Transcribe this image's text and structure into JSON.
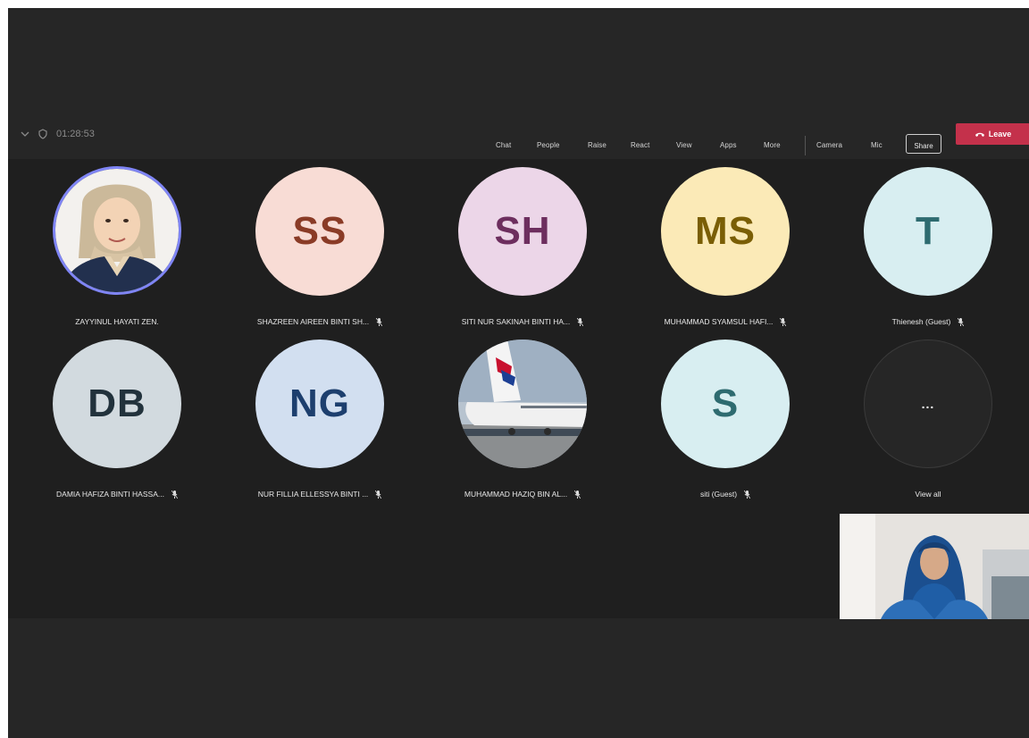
{
  "toolbar": {
    "timer": "01:28:53",
    "items": [
      "Chat",
      "People",
      "Raise",
      "React",
      "View",
      "Apps",
      "More",
      "Camera",
      "Mic"
    ],
    "share_label": "Share",
    "leave_label": "Leave"
  },
  "participants": [
    {
      "initials": "",
      "name": "ZAYYINUL HAYATI ZEN.",
      "bg": "#ffffff",
      "fg": "#000000",
      "photo": "woman-portrait",
      "muted": false,
      "speaking": true
    },
    {
      "initials": "SS",
      "name": "SHAZREEN AIREEN BINTI SH...",
      "bg": "#f8dcd5",
      "fg": "#8a3b26",
      "muted": true
    },
    {
      "initials": "SH",
      "name": "SITI NUR SAKINAH BINTI HA...",
      "bg": "#ecd6e8",
      "fg": "#6d2e5e",
      "muted": true
    },
    {
      "initials": "MS",
      "name": "MUHAMMAD SYAMSUL HAFI...",
      "bg": "#fbeab7",
      "fg": "#7a5e05",
      "muted": true
    },
    {
      "initials": "T",
      "name": "Thienesh (Guest)",
      "bg": "#d8eef1",
      "fg": "#2e6b70",
      "muted": true
    },
    {
      "initials": "DB",
      "name": "DAMIA HAFIZA BINTI HASSA...",
      "bg": "#d2dadf",
      "fg": "#22323c",
      "muted": true
    },
    {
      "initials": "NG",
      "name": "NUR FILLIA ELLESSYA BINTI ...",
      "bg": "#d2dff0",
      "fg": "#1d3f6e",
      "muted": true
    },
    {
      "initials": "",
      "name": "MUHAMMAD HAZIQ BIN AL...",
      "bg": "#9fb0bf",
      "fg": "#000000",
      "photo": "airplane",
      "muted": true
    },
    {
      "initials": "S",
      "name": "siti (Guest)",
      "bg": "#d8eef1",
      "fg": "#2e6b70",
      "muted": true
    },
    {
      "initials": "...",
      "name": "View all",
      "bg": "#262626",
      "fg": "#ffffff",
      "muted": false
    }
  ],
  "colors": {
    "stage_bg": "#1f1f1f",
    "frame_bg": "#262626",
    "leave_red": "#c4314b",
    "speaking_ring": "#7f85f5"
  }
}
